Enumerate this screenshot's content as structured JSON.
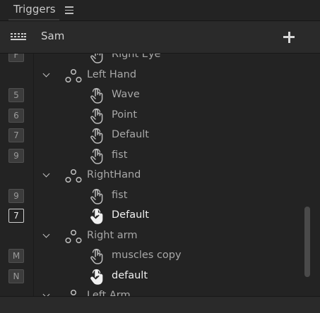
{
  "panel": {
    "title": "Triggers",
    "puppet_name": "Sam"
  },
  "icons": {
    "menu": "hamburger-menu-icon",
    "keyboard": "keyboard-icon",
    "add": "plus-icon",
    "group": "group-nodes-icon",
    "hand": "hand-pointer-icon",
    "chevron": "chevron-down-icon"
  },
  "rows": [
    {
      "type": "trigger",
      "key": "F",
      "label": "Right Eye",
      "selected": false
    },
    {
      "type": "group",
      "label": "Left Hand"
    },
    {
      "type": "trigger",
      "key": "5",
      "label": "Wave",
      "selected": false
    },
    {
      "type": "trigger",
      "key": "6",
      "label": "Point",
      "selected": false
    },
    {
      "type": "trigger",
      "key": "7",
      "label": "Default",
      "selected": false
    },
    {
      "type": "trigger",
      "key": "9",
      "label": "fist",
      "selected": false
    },
    {
      "type": "group",
      "label": "RightHand"
    },
    {
      "type": "trigger",
      "key": "9",
      "label": "fist",
      "selected": false
    },
    {
      "type": "trigger",
      "key": "7",
      "label": "Default",
      "selected": true
    },
    {
      "type": "group",
      "label": "Right arm"
    },
    {
      "type": "trigger",
      "key": "M",
      "label": "muscles copy",
      "selected": false
    },
    {
      "type": "trigger",
      "key": "N",
      "label": "default",
      "selected": true
    },
    {
      "type": "group",
      "label": "Left Arm"
    }
  ],
  "colors": {
    "background": "#232323",
    "header": "#2a2a2a",
    "text": "#a8a8a8",
    "selected_text": "#f0f0f0"
  }
}
